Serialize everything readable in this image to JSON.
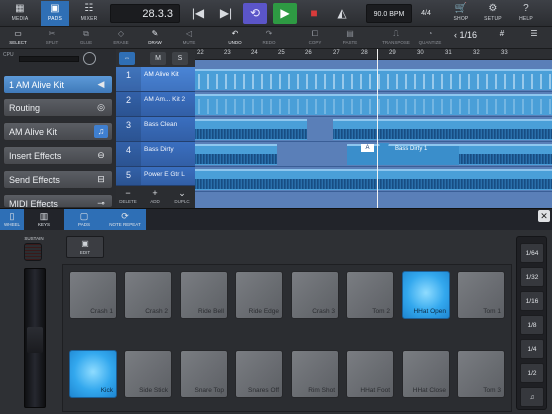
{
  "topbar": {
    "media": "MEDIA",
    "pads": "PADS",
    "mixer": "MIXER",
    "position": "28.3.3",
    "bpm": "90.0 BPM",
    "time_signature": "4/4",
    "shop": "SHOP",
    "setup": "SETUP",
    "help": "HELP"
  },
  "toolbar": {
    "select": "SELECT",
    "split": "SPLIT",
    "glue": "GLUE",
    "erase": "ERASE",
    "draw": "DRAW",
    "mute": "MUTE",
    "undo": "UNDO",
    "redo": "REDO",
    "copy": "COPY",
    "paste": "PASTE",
    "transpose": "TRANSPOSE",
    "quantize": "QUANTIZE",
    "quantize_value": "1/16"
  },
  "left_panel": {
    "cpu_label": "CPU",
    "instrument": "1 AM Alive Kit",
    "items": [
      "Routing",
      "AM Alive Kit",
      "Insert Effects",
      "Send Effects",
      "MIDI Effects"
    ]
  },
  "track_buttons": {
    "m": "M",
    "s": "S"
  },
  "tracks": [
    {
      "num": "1",
      "name": "AM Alive Kit"
    },
    {
      "num": "2",
      "name": "AM Am... Kit 2"
    },
    {
      "num": "3",
      "name": "Bass Clean"
    },
    {
      "num": "4",
      "name": "Bass Dirty"
    },
    {
      "num": "5",
      "name": "Power E Gtr L"
    }
  ],
  "track_footer": {
    "delete": "DELETE",
    "add": "ADD",
    "duplc": "DUPLC"
  },
  "ruler_ticks": [
    "22",
    "23",
    "24",
    "25",
    "26",
    "27",
    "28",
    "29",
    "30",
    "31",
    "32",
    "33"
  ],
  "clip_label": "Bass Dirty 1",
  "automation_badge": "A",
  "lower_tabs": {
    "wheel": "WHEEL",
    "keys": "KEYS",
    "pads": "PADS",
    "note_repeat": "NOTE REPEAT"
  },
  "sustain_label": "SUSTAIN",
  "edit_label": "EDIT",
  "pads": [
    {
      "label": "Crash 1",
      "lit": false
    },
    {
      "label": "Crash 2",
      "lit": false
    },
    {
      "label": "Ride Bell",
      "lit": false
    },
    {
      "label": "Ride Edge",
      "lit": false
    },
    {
      "label": "Crash 3",
      "lit": false
    },
    {
      "label": "Tom 2",
      "lit": false
    },
    {
      "label": "HHat Open",
      "lit": true
    },
    {
      "label": "Tom 1",
      "lit": false
    },
    {
      "label": "Kick",
      "lit": true
    },
    {
      "label": "Side Stick",
      "lit": false
    },
    {
      "label": "Snare Top",
      "lit": false
    },
    {
      "label": "Snares Off",
      "lit": false
    },
    {
      "label": "Rim Shot",
      "lit": false
    },
    {
      "label": "HHat Foot",
      "lit": false
    },
    {
      "label": "HHat Close",
      "lit": false
    },
    {
      "label": "Tom 3",
      "lit": false
    }
  ],
  "repeat_rates": [
    "1/64",
    "1/32",
    "1/16",
    "1/8",
    "1/4",
    "1/2"
  ]
}
